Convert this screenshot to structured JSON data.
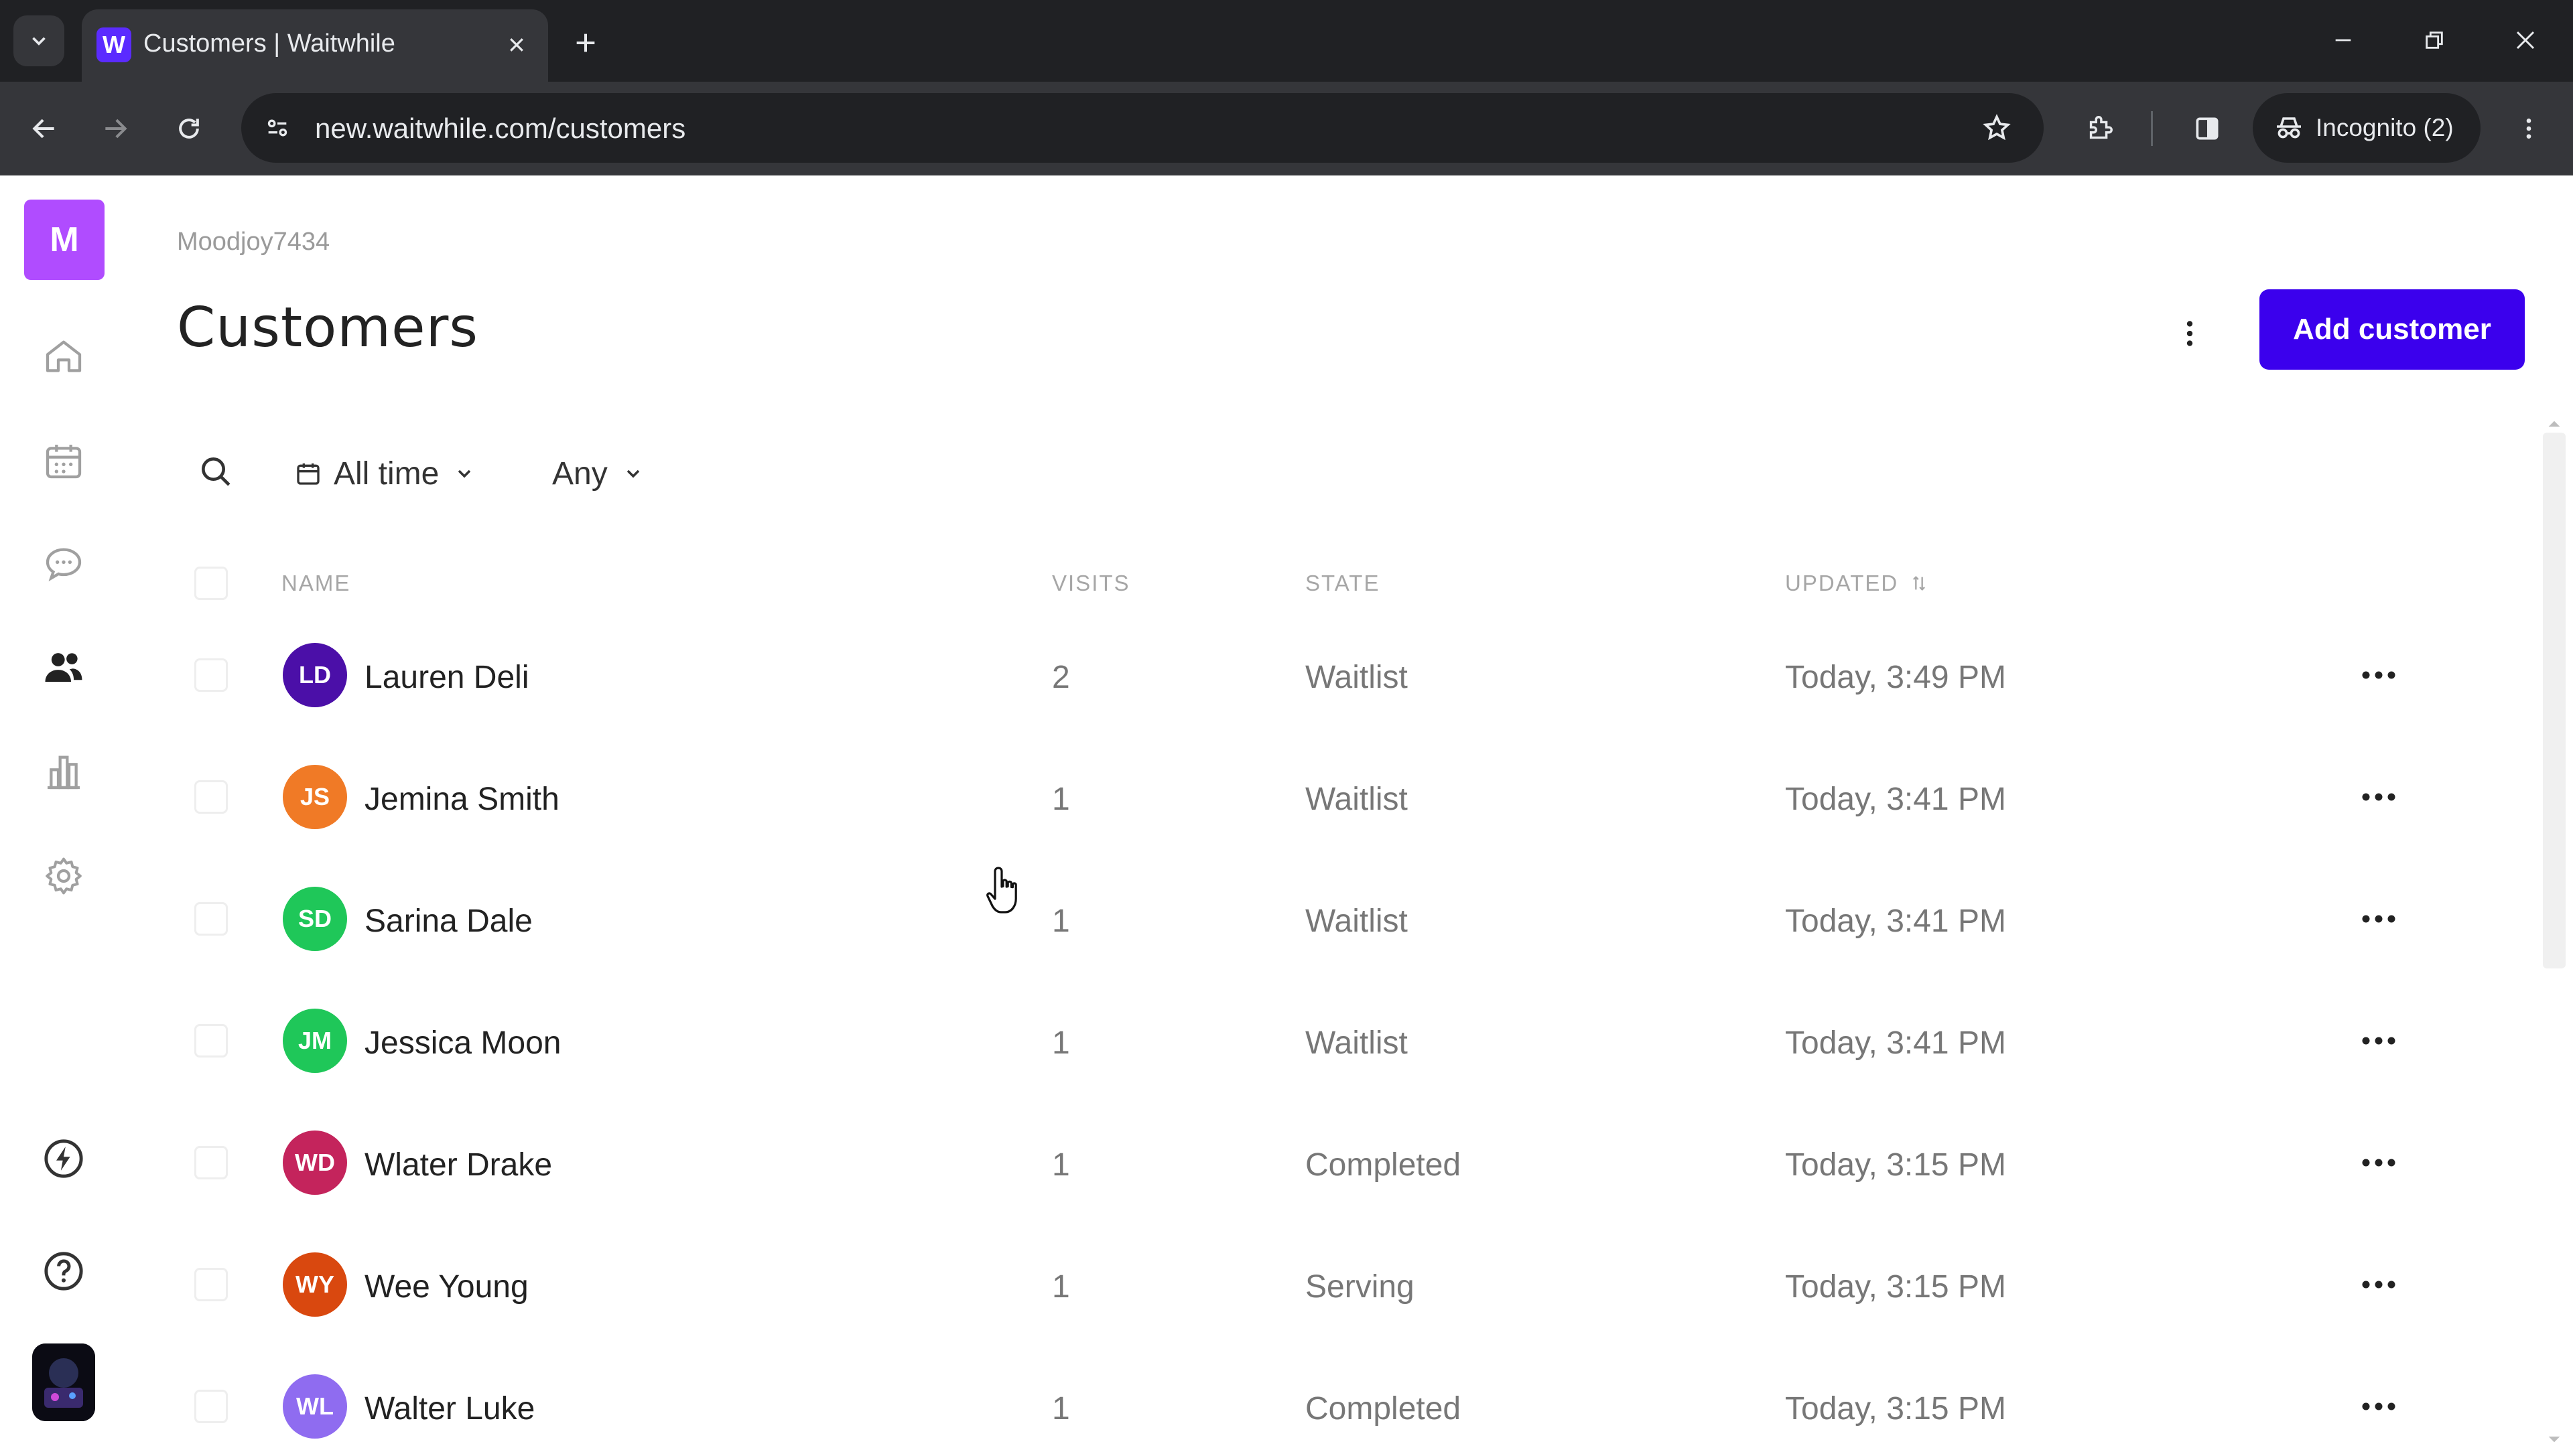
{
  "browser": {
    "tab_title": "Customers | Waitwhile",
    "favicon_letter": "W",
    "url": "new.waitwhile.com/customers",
    "incognito_label": "Incognito (2)"
  },
  "sidebar": {
    "workspace_initial": "M",
    "items": [
      {
        "name": "home",
        "icon": "home-icon"
      },
      {
        "name": "calendar",
        "icon": "calendar-icon"
      },
      {
        "name": "messages",
        "icon": "chat-icon"
      },
      {
        "name": "customers",
        "icon": "people-icon",
        "active": true
      },
      {
        "name": "analytics",
        "icon": "bar-chart-icon"
      },
      {
        "name": "settings",
        "icon": "gear-icon"
      },
      {
        "name": "whats-new",
        "icon": "lightning-icon"
      },
      {
        "name": "help",
        "icon": "help-icon"
      }
    ]
  },
  "header": {
    "workspace_name": "Moodjoy7434",
    "title": "Customers",
    "add_button": "Add customer"
  },
  "filters": {
    "date_filter": "All time",
    "state_filter": "Any"
  },
  "table": {
    "columns": {
      "name": "NAME",
      "visits": "VISITS",
      "state": "STATE",
      "updated": "UPDATED"
    },
    "rows": [
      {
        "initials": "LD",
        "color": "#4b0fa8",
        "name": "Lauren Deli",
        "visits": "2",
        "state": "Waitlist",
        "updated": "Today, 3:49 PM"
      },
      {
        "initials": "JS",
        "color": "#f07a26",
        "name": "Jemina Smith",
        "visits": "1",
        "state": "Waitlist",
        "updated": "Today, 3:41 PM"
      },
      {
        "initials": "SD",
        "color": "#1fc759",
        "name": "Sarina Dale",
        "visits": "1",
        "state": "Waitlist",
        "updated": "Today, 3:41 PM"
      },
      {
        "initials": "JM",
        "color": "#1fc759",
        "name": "Jessica Moon",
        "visits": "1",
        "state": "Waitlist",
        "updated": "Today, 3:41 PM"
      },
      {
        "initials": "WD",
        "color": "#c4245c",
        "name": "Wlater Drake",
        "visits": "1",
        "state": "Completed",
        "updated": "Today, 3:15 PM"
      },
      {
        "initials": "WY",
        "color": "#d9480f",
        "name": "Wee Young",
        "visits": "1",
        "state": "Serving",
        "updated": "Today, 3:15 PM"
      },
      {
        "initials": "WL",
        "color": "#8f6cf0",
        "name": "Walter Luke",
        "visits": "1",
        "state": "Completed",
        "updated": "Today, 3:15 PM"
      }
    ]
  },
  "colors": {
    "accent": "#3b00ed",
    "workspace_badge": "#b04cff"
  }
}
